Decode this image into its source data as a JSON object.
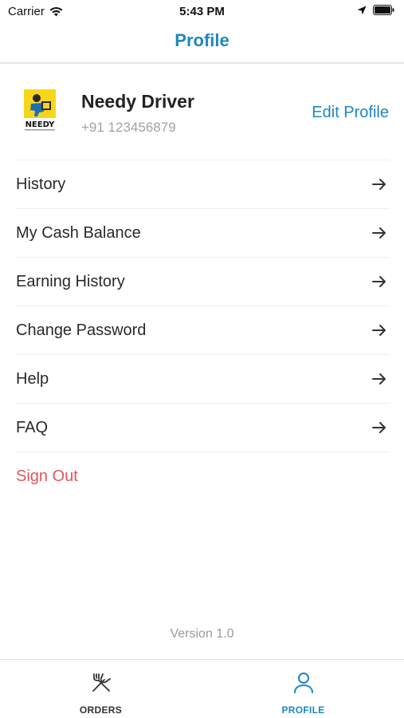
{
  "status_bar": {
    "carrier": "Carrier",
    "time": "5:43 PM"
  },
  "nav": {
    "title": "Profile"
  },
  "profile": {
    "name": "Needy Driver",
    "phone": "+91 123456879",
    "edit_label": "Edit Profile",
    "logo_text": "NEEDY"
  },
  "menu": {
    "items": [
      {
        "label": "History",
        "icon": "arrow-right-icon"
      },
      {
        "label": "My Cash Balance",
        "icon": "arrow-right-icon"
      },
      {
        "label": "Earning History",
        "icon": "arrow-right-icon"
      },
      {
        "label": "Change Password",
        "icon": "arrow-right-icon"
      },
      {
        "label": "Help",
        "icon": "arrow-right-icon"
      },
      {
        "label": "FAQ",
        "icon": "arrow-right-icon"
      }
    ],
    "sign_out": "Sign Out"
  },
  "version": "Version 1.0",
  "tabs": [
    {
      "label": "ORDERS",
      "icon": "fork-knife-icon",
      "active": false
    },
    {
      "label": "PROFILE",
      "icon": "person-icon",
      "active": true
    }
  ],
  "colors": {
    "accent": "#1f86c1",
    "danger": "#e5555b",
    "muted": "#a2a2a2"
  }
}
